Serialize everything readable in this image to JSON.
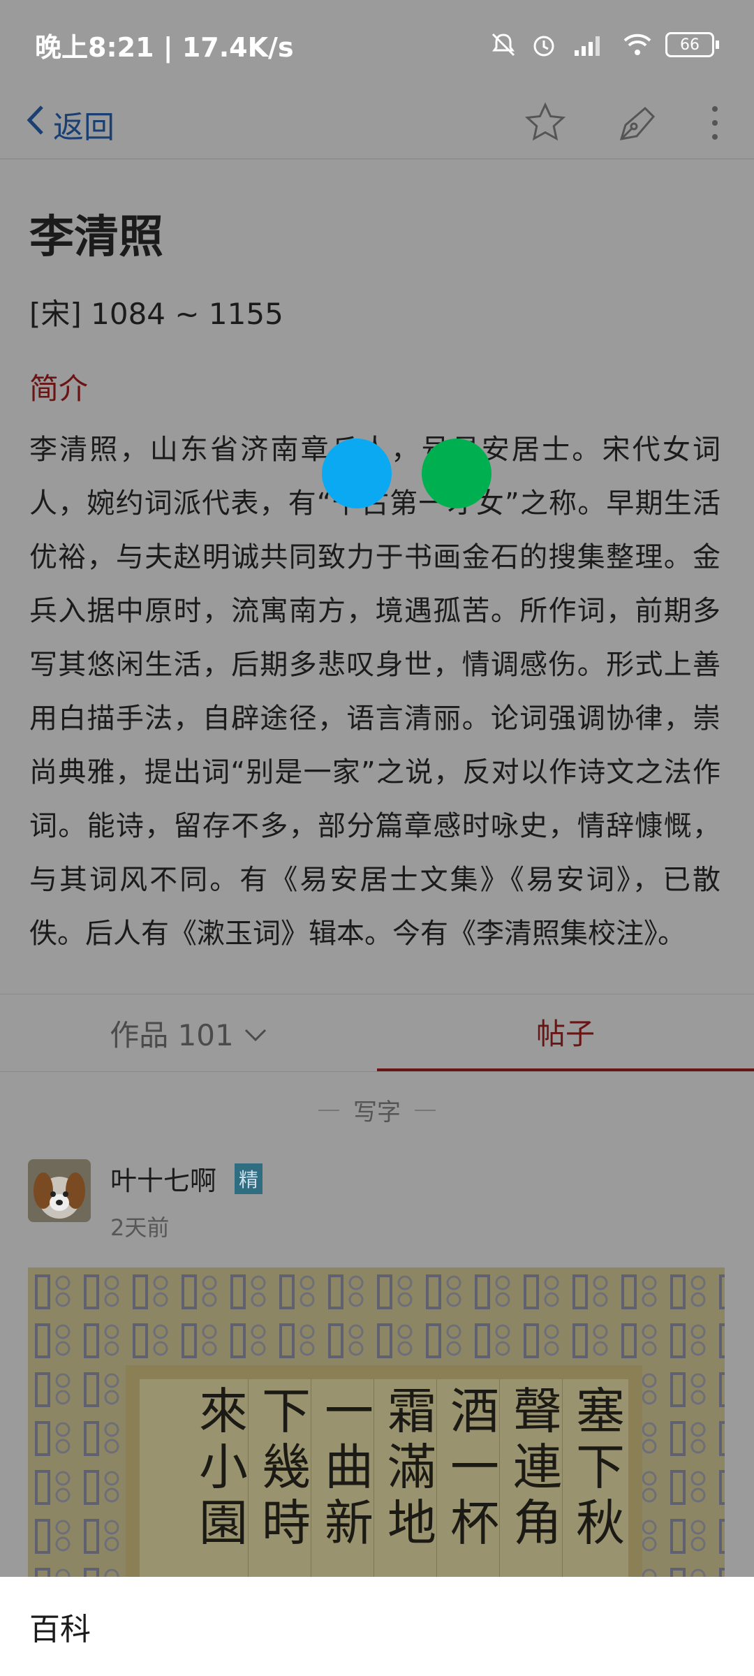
{
  "status_bar": {
    "time_speed": "晚上8:21 | 17.4K/s",
    "battery": "66",
    "icons": [
      "mute-icon",
      "alarm-icon",
      "hd-signal-icon",
      "wifi-icon",
      "battery-icon"
    ]
  },
  "nav": {
    "back_label": "返回",
    "icons": [
      "chevron-left-icon",
      "star-icon",
      "pen-icon",
      "more-vertical-icon"
    ]
  },
  "poet": {
    "name": "李清照",
    "dates": "[宋] 1084 ~ 1155",
    "section_label": "简介",
    "intro": "李清照，山东省济南章丘人，号易安居士。宋代女词人，婉约词派代表，有“千古第一才女”之称。早期生活优裕，与夫赵明诚共同致力于书画金石的搜集整理。金兵入据中原时，流寓南方，境遇孤苦。所作词，前期多写其悠闲生活，后期多悲叹身世，情调感伤。形式上善用白描手法，自辟途径，语言清丽。论词强调协律，崇尚典雅，提出词“别是一家”之说，反对以作诗文之法作词。能诗，留存不多，部分篇章感时咏史，情辞慷慨，与其词风不同。有《易安居士文集》《易安词》，已散佚。后人有《漱玉词》辑本。今有《李清照集校注》。"
  },
  "tabs": {
    "works_label": "作品 101",
    "posts_label": "帖子"
  },
  "feed": {
    "category_label": "写字",
    "post": {
      "user_name": "叶十七啊",
      "badge": "精",
      "time": "2天前"
    },
    "image_chars": [
      "塞",
      "下",
      "秋",
      "聲",
      "連",
      "角",
      "酒",
      "一",
      "杯",
      "霜",
      "滿",
      "地",
      "一",
      "曲",
      "新",
      "下",
      "幾",
      "時",
      "來",
      "小",
      "園"
    ]
  },
  "bottom_sheet": {
    "label": "百科"
  },
  "colors": {
    "accent": "#6b1414",
    "link_blue": "#1a3f73",
    "touch_blue": "#0aa9f2",
    "touch_green": "#00b050"
  }
}
